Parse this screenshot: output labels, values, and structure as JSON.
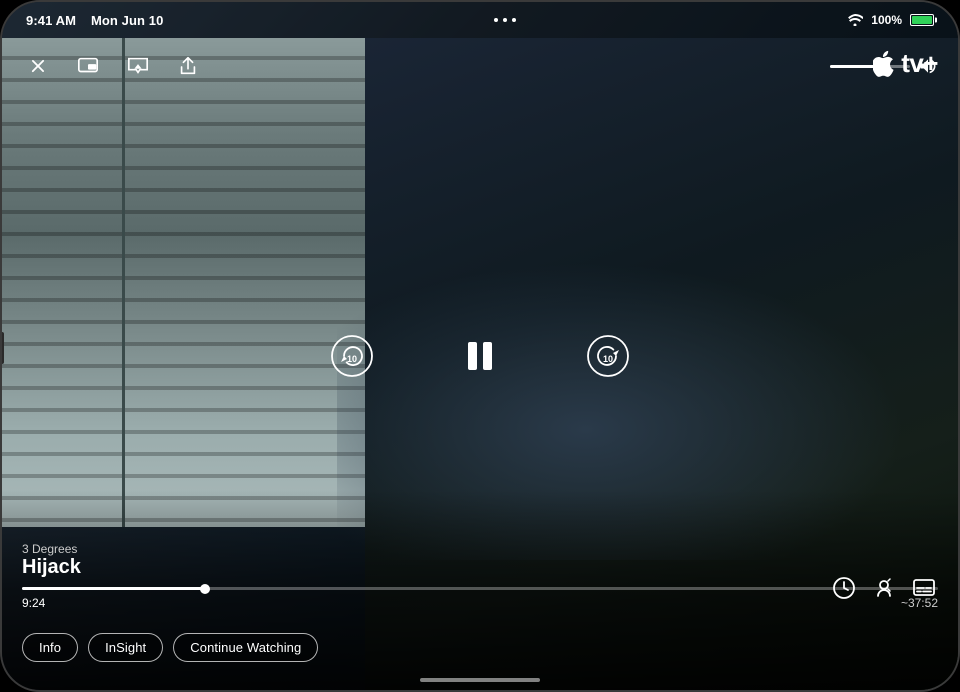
{
  "status_bar": {
    "time": "9:41 AM",
    "date": "Mon Jun 10",
    "dots": 3,
    "wifi": "WiFi",
    "battery_percent": "100%"
  },
  "appletv_logo": "tv+",
  "show": {
    "subtitle": "3 Degrees",
    "title": "Hijack"
  },
  "playback": {
    "current_time": "9:24",
    "remaining_time": "~37:52",
    "progress_percent": 20
  },
  "controls": {
    "close_label": "✕",
    "pip_label": "PiP",
    "airplay_label": "AirPlay",
    "share_label": "Share",
    "volume_label": "Volume",
    "rewind_label": "10",
    "pause_label": "⏸",
    "forward_label": "10"
  },
  "pill_buttons": [
    {
      "id": "info",
      "label": "Info"
    },
    {
      "id": "insight",
      "label": "InSight"
    },
    {
      "id": "continue-watching",
      "label": "Continue Watching"
    }
  ],
  "right_controls": [
    {
      "id": "playback-speed",
      "label": "Speed"
    },
    {
      "id": "audio",
      "label": "Audio"
    },
    {
      "id": "subtitles",
      "label": "Subtitles"
    }
  ]
}
